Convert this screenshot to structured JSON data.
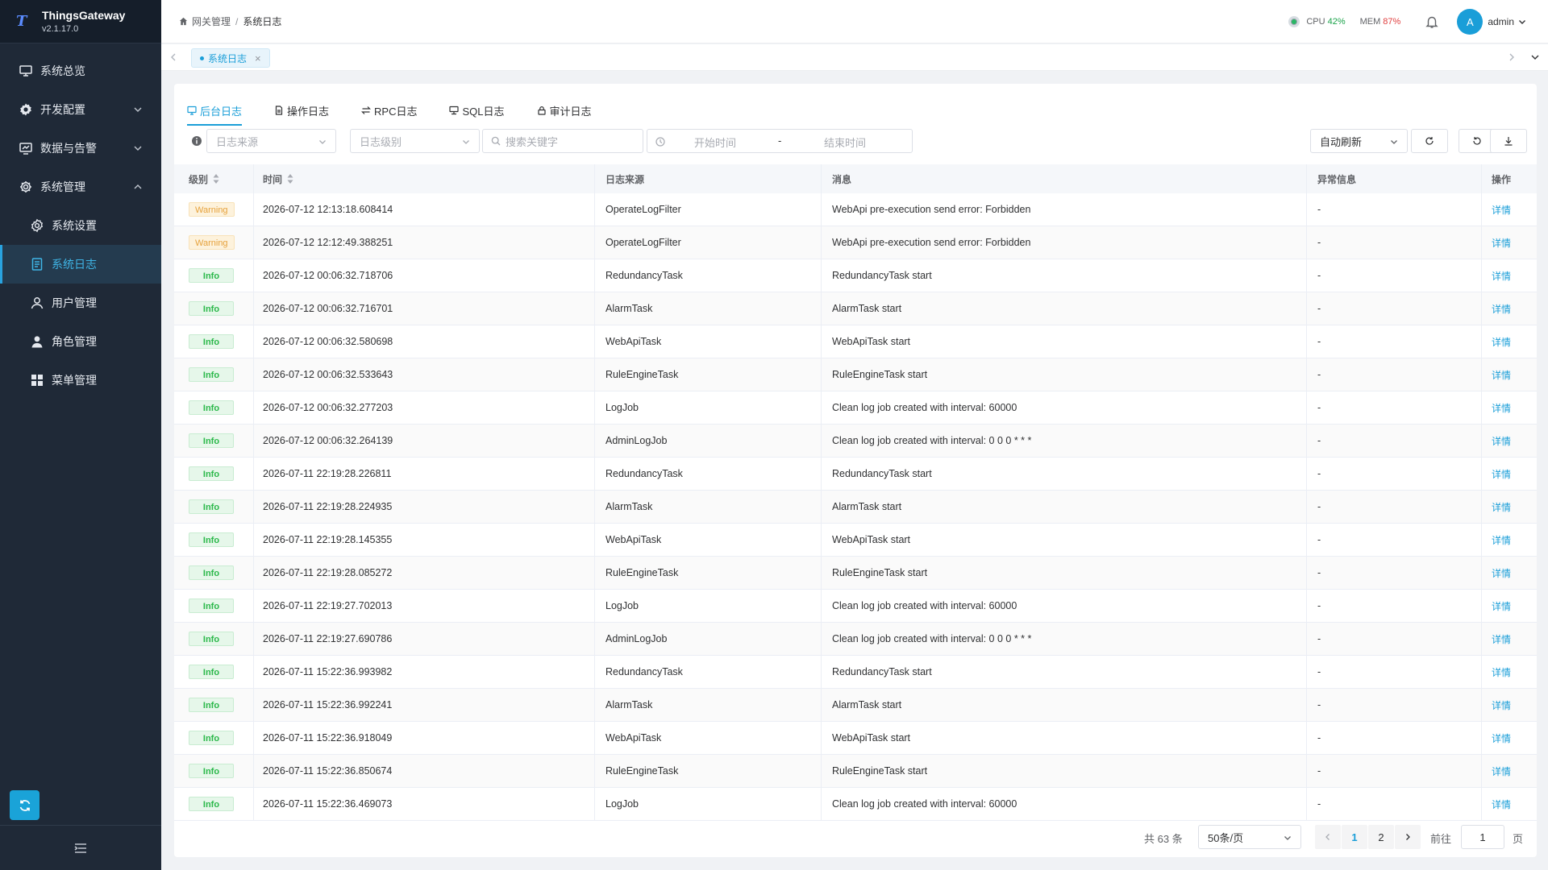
{
  "brand": {
    "name": "ThingsGateway",
    "version": "v2.1.17.0"
  },
  "sidebar": {
    "items": [
      {
        "label": "系统总览",
        "icon": "monitor-icon",
        "level": 1,
        "active": false,
        "expandable": false
      },
      {
        "label": "开发配置",
        "icon": "gear-icon",
        "level": 1,
        "active": false,
        "expandable": true,
        "expanded": false
      },
      {
        "label": "数据与告警",
        "icon": "chart-screen-icon",
        "level": 1,
        "active": false,
        "expandable": true,
        "expanded": false
      },
      {
        "label": "系统管理",
        "icon": "settings-icon",
        "level": 1,
        "active": false,
        "expandable": true,
        "expanded": true
      },
      {
        "label": "系统设置",
        "icon": "cog-icon",
        "level": 2,
        "active": false,
        "expandable": false
      },
      {
        "label": "系统日志",
        "icon": "document-icon",
        "level": 2,
        "active": true,
        "expandable": false
      },
      {
        "label": "用户管理",
        "icon": "user-outline-icon",
        "level": 2,
        "active": false,
        "expandable": false
      },
      {
        "label": "角色管理",
        "icon": "user-filled-icon",
        "level": 2,
        "active": false,
        "expandable": false
      },
      {
        "label": "菜单管理",
        "icon": "grid-icon",
        "level": 2,
        "active": false,
        "expandable": false
      }
    ]
  },
  "header": {
    "breadcrumb": [
      "网关管理",
      "系统日志"
    ],
    "cpu_label": "CPU",
    "cpu_value": "42%",
    "mem_label": "MEM",
    "mem_value": "87%",
    "user_initial": "A",
    "username": "admin"
  },
  "tagsbar": {
    "tab_label": "系统日志"
  },
  "tabs": [
    {
      "label": "后台日志",
      "icon": "monitor-icon",
      "active": true
    },
    {
      "label": "操作日志",
      "icon": "file-icon",
      "active": false
    },
    {
      "label": "RPC日志",
      "icon": "exchange-icon",
      "active": false
    },
    {
      "label": "SQL日志",
      "icon": "database-icon",
      "active": false
    },
    {
      "label": "审计日志",
      "icon": "lock-icon",
      "active": false
    }
  ],
  "filters": {
    "source_placeholder": "日志来源",
    "level_placeholder": "日志级别",
    "search_placeholder": "搜索关键字",
    "start_placeholder": "开始时间",
    "range_separator": "-",
    "end_placeholder": "结束时间",
    "auto_refresh": "自动刷新"
  },
  "table": {
    "columns": {
      "level": "级别",
      "time": "时间",
      "source": "日志来源",
      "message": "消息",
      "exception": "异常信息",
      "action": "操作"
    },
    "detail_label": "详情",
    "rows": [
      {
        "level": "Warning",
        "time": "2026-07-12 12:13:18.608414",
        "source": "OperateLogFilter",
        "message": "WebApi pre-execution send error: Forbidden",
        "exception": "-"
      },
      {
        "level": "Warning",
        "time": "2026-07-12 12:12:49.388251",
        "source": "OperateLogFilter",
        "message": "WebApi pre-execution send error: Forbidden",
        "exception": "-"
      },
      {
        "level": "Info",
        "time": "2026-07-12 00:06:32.718706",
        "source": "RedundancyTask",
        "message": "RedundancyTask start",
        "exception": "-"
      },
      {
        "level": "Info",
        "time": "2026-07-12 00:06:32.716701",
        "source": "AlarmTask",
        "message": "AlarmTask start",
        "exception": "-"
      },
      {
        "level": "Info",
        "time": "2026-07-12 00:06:32.580698",
        "source": "WebApiTask",
        "message": "WebApiTask start",
        "exception": "-"
      },
      {
        "level": "Info",
        "time": "2026-07-12 00:06:32.533643",
        "source": "RuleEngineTask",
        "message": "RuleEngineTask start",
        "exception": "-"
      },
      {
        "level": "Info",
        "time": "2026-07-12 00:06:32.277203",
        "source": "LogJob",
        "message": "Clean log job created with interval: 60000",
        "exception": "-"
      },
      {
        "level": "Info",
        "time": "2026-07-12 00:06:32.264139",
        "source": "AdminLogJob",
        "message": "Clean log job created with interval: 0 0 0 * * *",
        "exception": "-"
      },
      {
        "level": "Info",
        "time": "2026-07-11 22:19:28.226811",
        "source": "RedundancyTask",
        "message": "RedundancyTask start",
        "exception": "-"
      },
      {
        "level": "Info",
        "time": "2026-07-11 22:19:28.224935",
        "source": "AlarmTask",
        "message": "AlarmTask start",
        "exception": "-"
      },
      {
        "level": "Info",
        "time": "2026-07-11 22:19:28.145355",
        "source": "WebApiTask",
        "message": "WebApiTask start",
        "exception": "-"
      },
      {
        "level": "Info",
        "time": "2026-07-11 22:19:28.085272",
        "source": "RuleEngineTask",
        "message": "RuleEngineTask start",
        "exception": "-"
      },
      {
        "level": "Info",
        "time": "2026-07-11 22:19:27.702013",
        "source": "LogJob",
        "message": "Clean log job created with interval: 60000",
        "exception": "-"
      },
      {
        "level": "Info",
        "time": "2026-07-11 22:19:27.690786",
        "source": "AdminLogJob",
        "message": "Clean log job created with interval: 0 0 0 * * *",
        "exception": "-"
      },
      {
        "level": "Info",
        "time": "2026-07-11 15:22:36.993982",
        "source": "RedundancyTask",
        "message": "RedundancyTask start",
        "exception": "-"
      },
      {
        "level": "Info",
        "time": "2026-07-11 15:22:36.992241",
        "source": "AlarmTask",
        "message": "AlarmTask start",
        "exception": "-"
      },
      {
        "level": "Info",
        "time": "2026-07-11 15:22:36.918049",
        "source": "WebApiTask",
        "message": "WebApiTask start",
        "exception": "-"
      },
      {
        "level": "Info",
        "time": "2026-07-11 15:22:36.850674",
        "source": "RuleEngineTask",
        "message": "RuleEngineTask start",
        "exception": "-"
      },
      {
        "level": "Info",
        "time": "2026-07-11 15:22:36.469073",
        "source": "LogJob",
        "message": "Clean log job created with interval: 60000",
        "exception": "-"
      }
    ]
  },
  "pagination": {
    "total_text": "共 63 条",
    "page_size": "50条/页",
    "pages": [
      "1",
      "2"
    ],
    "current_page": "1",
    "goto_label": "前往",
    "goto_value": "1",
    "page_unit": "页"
  },
  "colors": {
    "accent": "#1a9ed8",
    "sidebar_bg": "#1f2937",
    "warning": "#e6a23c",
    "info": "#2bb84a",
    "cpu": "#1aa34a",
    "mem": "#e04040"
  }
}
